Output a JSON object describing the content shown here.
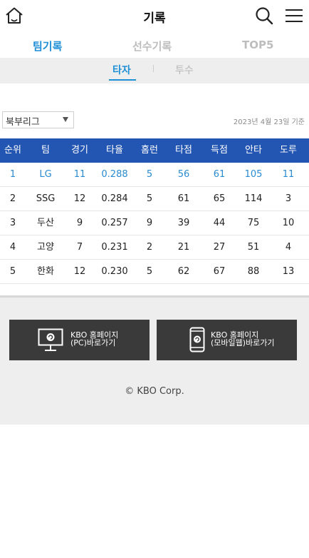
{
  "header": {
    "title": "기록",
    "icons": {
      "home": "home-icon",
      "search": "search-icon",
      "menu": "hamburger-menu-icon"
    }
  },
  "main_tabs": [
    {
      "label": "팀기록",
      "active": true
    },
    {
      "label": "선수기록",
      "active": false
    },
    {
      "label": "TOP5",
      "active": false
    }
  ],
  "sub_tabs": [
    {
      "label": "타자",
      "active": true
    },
    {
      "label": "투수",
      "active": false
    }
  ],
  "filter": {
    "league_selected": "북부리그",
    "base_date": "2023년 4월 23일 기준"
  },
  "table": {
    "headers": [
      "순위",
      "팀",
      "경기",
      "타율",
      "홈런",
      "타점",
      "득점",
      "안타",
      "도루"
    ],
    "rows": [
      [
        "1",
        "LG",
        "11",
        "0.288",
        "5",
        "56",
        "61",
        "105",
        "11"
      ],
      [
        "2",
        "SSG",
        "12",
        "0.284",
        "5",
        "61",
        "65",
        "114",
        "3"
      ],
      [
        "3",
        "두산",
        "9",
        "0.257",
        "9",
        "39",
        "44",
        "75",
        "10"
      ],
      [
        "4",
        "고양",
        "7",
        "0.231",
        "2",
        "21",
        "27",
        "51",
        "4"
      ],
      [
        "5",
        "한화",
        "12",
        "0.230",
        "5",
        "62",
        "67",
        "88",
        "13"
      ]
    ],
    "highlight_row_color": "#2a8bd0",
    "header_bg": "#2355b2"
  },
  "footer": {
    "pc_button": {
      "line1": "KBO 홈페이지",
      "line2": "(PC)바로가기",
      "icon": "monitor-icon"
    },
    "mobile_button": {
      "line1": "KBO 홈페이지",
      "line2": "(모바일웹)바로가기",
      "icon": "smartphone-icon"
    },
    "copyright": "© KBO Corp."
  },
  "colors": {
    "accent": "#1f8fd6",
    "header": "#2355b2",
    "button_bg": "#3a3a3a"
  }
}
